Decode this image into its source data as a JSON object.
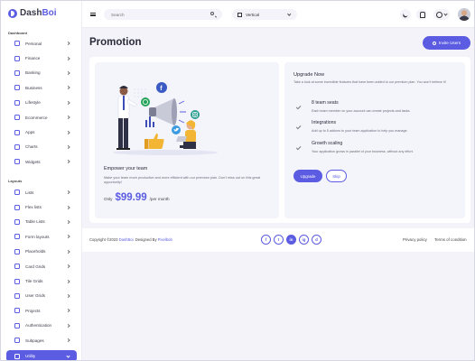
{
  "brand": {
    "name_prefix": "Dash",
    "name_suffix": "Boi"
  },
  "sidebar": {
    "section_dashboard": "Dashboard",
    "dashboard_items": [
      {
        "label": "Personal",
        "icon": "home-icon"
      },
      {
        "label": "Finance",
        "icon": "finance-icon"
      },
      {
        "label": "Banking",
        "icon": "bank-icon"
      },
      {
        "label": "Business",
        "icon": "business-icon"
      },
      {
        "label": "Lifestyle",
        "icon": "lifestyle-icon"
      },
      {
        "label": "Ecommerce",
        "icon": "cart-icon"
      },
      {
        "label": "Apps",
        "icon": "apps-icon"
      },
      {
        "label": "Charts",
        "icon": "charts-icon"
      },
      {
        "label": "Widgets",
        "icon": "widgets-icon"
      }
    ],
    "section_layouts": "Layouts",
    "layout_items": [
      {
        "label": "Lists",
        "icon": "lists-icon"
      },
      {
        "label": "Flex lists",
        "icon": "flex-lists-icon"
      },
      {
        "label": "Table Lists",
        "icon": "table-lists-icon"
      },
      {
        "label": "Form layouts",
        "icon": "form-icon"
      },
      {
        "label": "Placeholds",
        "icon": "placeholder-icon"
      },
      {
        "label": "Card Grids",
        "icon": "card-grid-icon"
      },
      {
        "label": "Tile Grids",
        "icon": "tile-grid-icon"
      },
      {
        "label": "User Grids",
        "icon": "user-grid-icon"
      },
      {
        "label": "Projects",
        "icon": "projects-icon"
      },
      {
        "label": "Authentication",
        "icon": "lock-icon"
      },
      {
        "label": "Subpages",
        "icon": "subpages-icon"
      }
    ],
    "active_item": {
      "label": "Utility",
      "icon": "utility-icon"
    }
  },
  "topbar": {
    "search_placeholder": "Search",
    "layout_value": "Vertical"
  },
  "main": {
    "title": "Promotion",
    "invite_label": "Invite Users"
  },
  "promo": {
    "title": "Empower your team",
    "description": "Make your team more productive and more efficient with our premium plan. Don't miss out on this great opportunity!",
    "price_prefix": "Only",
    "price": "$99.99",
    "price_suffix": "/per month"
  },
  "upgrade": {
    "title": "Upgrade Now",
    "description": "Take a look at some incredible features that have been added to our premium plan. You won't believe it!",
    "features": [
      {
        "title": "8 team seats",
        "desc": "Each team member on your account can create projects and tasks."
      },
      {
        "title": "Integrations",
        "desc": "Add up to 5 addons to your team application to help you manage."
      },
      {
        "title": "Growth scaling",
        "desc": "Your application grows in parallel of your business, without any effort."
      }
    ],
    "upgrade_label": "Upgrade",
    "skip_label": "Skip"
  },
  "footer": {
    "copyright_prefix": "Copyright ©2023",
    "brand": "DashBoi",
    "designed_by": ". Designed By",
    "designer": "Pixelbob",
    "socials": [
      "f",
      "t",
      "in",
      "ig",
      "d"
    ],
    "privacy": "Privacy policy",
    "terms": "Terms of condition"
  },
  "colors": {
    "accent": "#5b5ce2",
    "background": "#f3f3f9"
  }
}
